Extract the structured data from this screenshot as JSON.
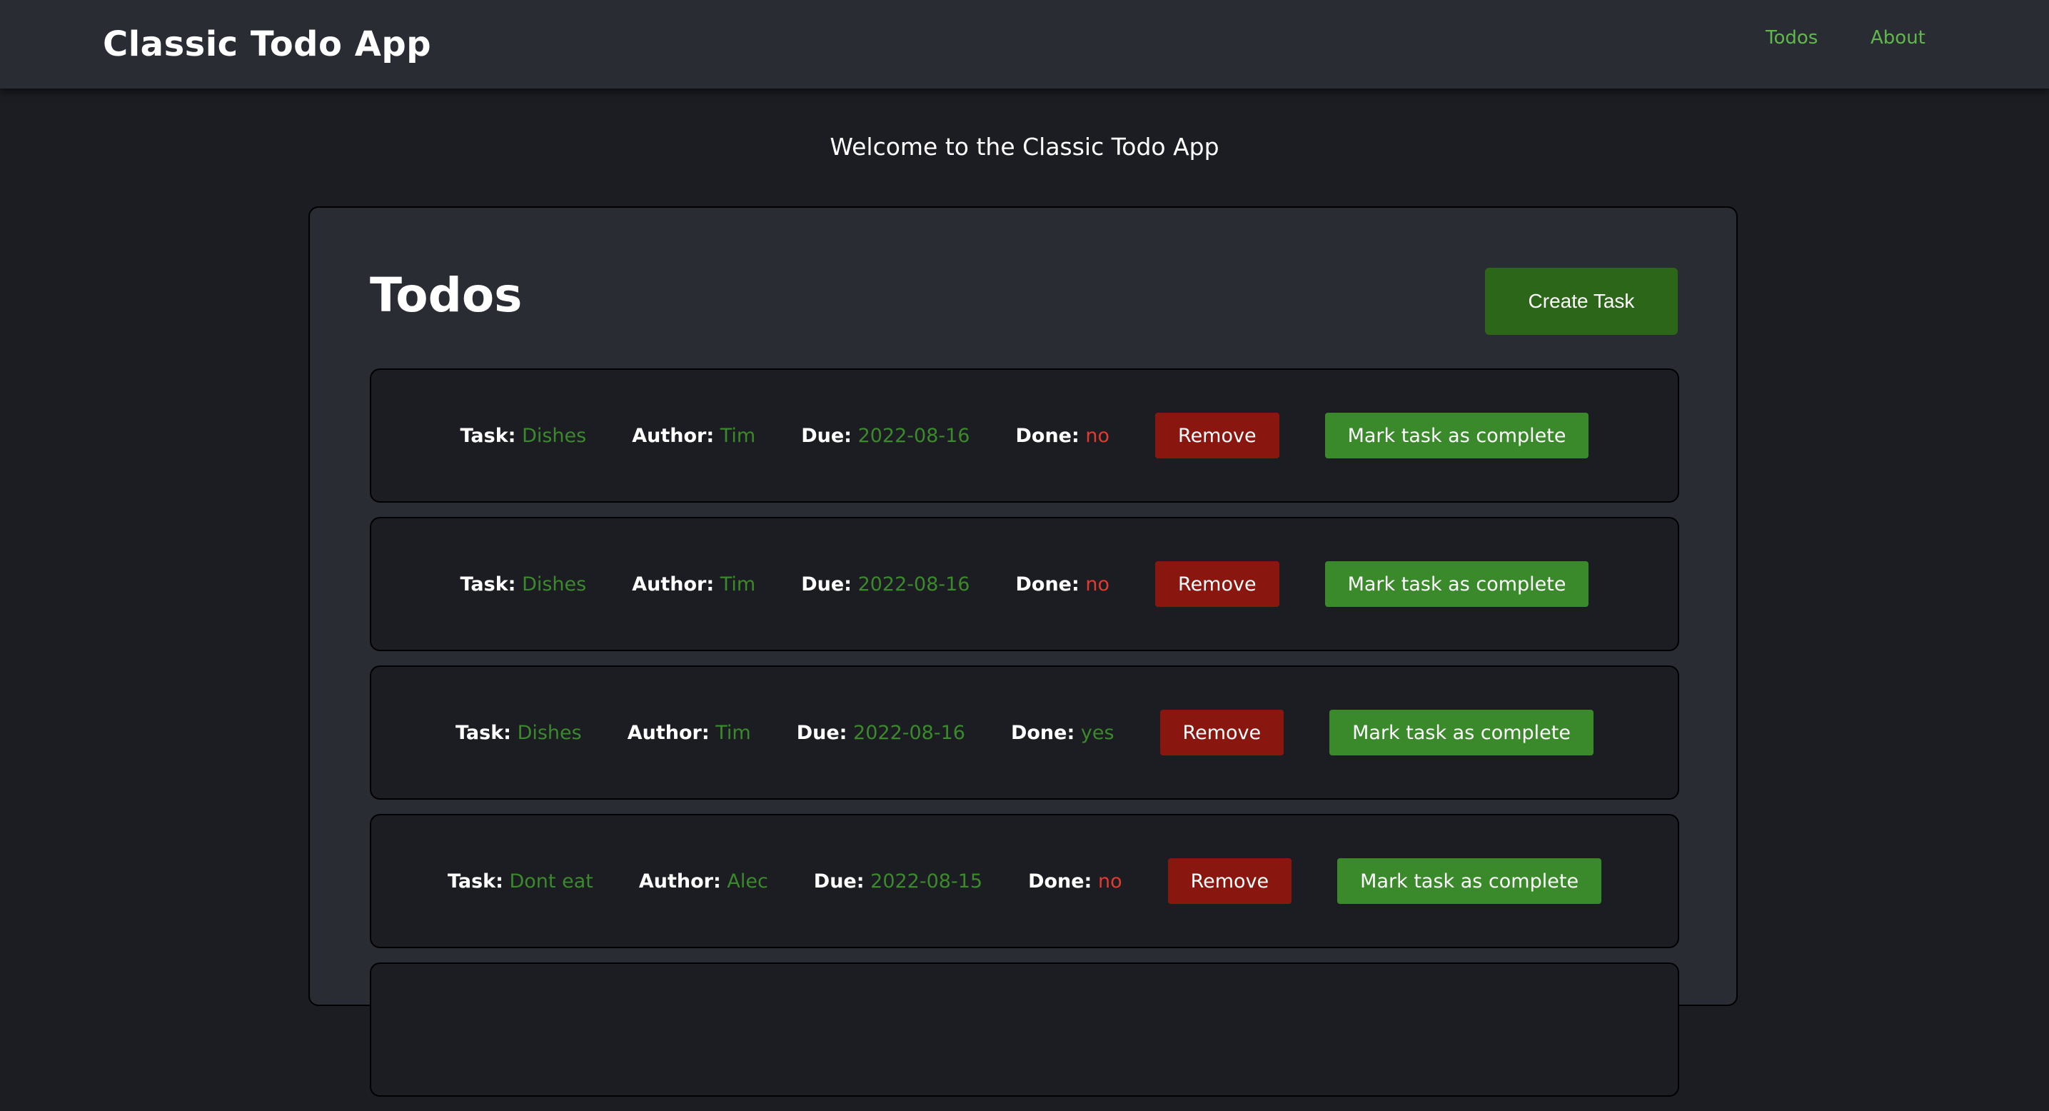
{
  "header": {
    "brand": "Classic Todo App",
    "nav": [
      {
        "label": "Todos"
      },
      {
        "label": "About"
      }
    ]
  },
  "welcome": "Welcome to the Classic Todo App",
  "panel": {
    "title": "Todos",
    "create_label": "Create Task"
  },
  "labels": {
    "task": "Task:",
    "author": "Author:",
    "due": "Due:",
    "done": "Done:",
    "remove": "Remove",
    "complete": "Mark task as complete"
  },
  "colors": {
    "accent_green": "#3a8a2b",
    "danger_red": "#8a1610",
    "done_no": "#e03b2e",
    "background": "#1c1d22",
    "surface": "#2a2c34"
  },
  "todos": [
    {
      "task": "Dishes",
      "author": "Tim",
      "due": "2022-08-16",
      "done": "no"
    },
    {
      "task": "Dishes",
      "author": "Tim",
      "due": "2022-08-16",
      "done": "no"
    },
    {
      "task": "Dishes",
      "author": "Tim",
      "due": "2022-08-16",
      "done": "yes"
    },
    {
      "task": "Dont eat",
      "author": "Alec",
      "due": "2022-08-15",
      "done": "no"
    },
    {
      "task": "",
      "author": "",
      "due": "",
      "done": ""
    }
  ]
}
